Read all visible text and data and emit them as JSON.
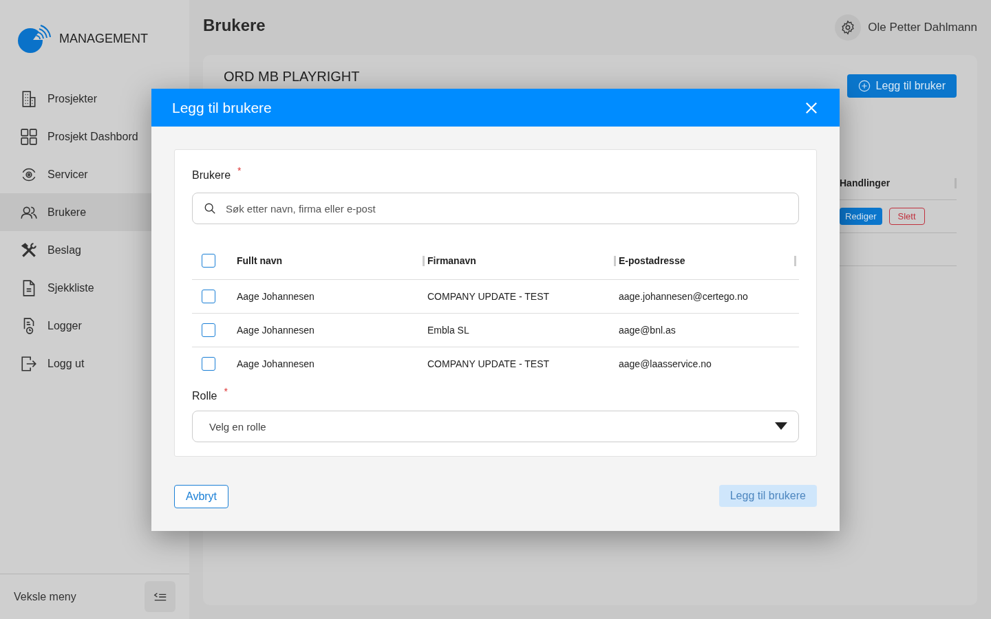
{
  "brand": {
    "name": "MANAGEMENT"
  },
  "sidebar": {
    "items": [
      {
        "label": "Prosjekter",
        "selected": false
      },
      {
        "label": "Prosjekt Dashbord",
        "selected": false
      },
      {
        "label": "Servicer",
        "selected": false
      },
      {
        "label": "Brukere",
        "selected": true
      },
      {
        "label": "Beslag",
        "selected": false
      },
      {
        "label": "Sjekkliste",
        "selected": false
      },
      {
        "label": "Logger",
        "selected": false
      },
      {
        "label": "Logg ut",
        "selected": false
      }
    ],
    "toggle_label": "Veksle meny"
  },
  "header": {
    "title": "Brukere",
    "user_name": "Ole Petter Dahlmann"
  },
  "page": {
    "project_title": "ORD MB PLAYRIGHT",
    "add_button": "Legg til bruker",
    "actions_heading": "Handlinger",
    "edit_button": "Rediger",
    "delete_button": "Slett"
  },
  "dialog": {
    "title": "Legg til brukere",
    "users_label": "Brukere",
    "required_mark": "*",
    "search": {
      "placeholder": "Søk etter navn, firma eller e-post"
    },
    "table": {
      "select_all_checked": false,
      "columns": [
        "Fullt navn",
        "Firmanavn",
        "E-postadresse"
      ],
      "rows": [
        {
          "name": "Aage Johannesen",
          "company": "COMPANY UPDATE - TEST",
          "email": "aage.johannesen@certego.no",
          "checked": false
        },
        {
          "name": "Aage Johannesen",
          "company": "Embla SL",
          "email": "aage@bnl.as",
          "checked": false
        },
        {
          "name": "Aage Johannesen",
          "company": "COMPANY UPDATE - TEST",
          "email": "aage@laasservice.no",
          "checked": false
        }
      ]
    },
    "role_label": "Rolle",
    "role_required_mark": "*",
    "role_select": {
      "placeholder": "Velg en rolle"
    },
    "cancel_button": "Avbryt",
    "submit_button": {
      "label": "Legg til brukere",
      "disabled": true
    }
  }
}
